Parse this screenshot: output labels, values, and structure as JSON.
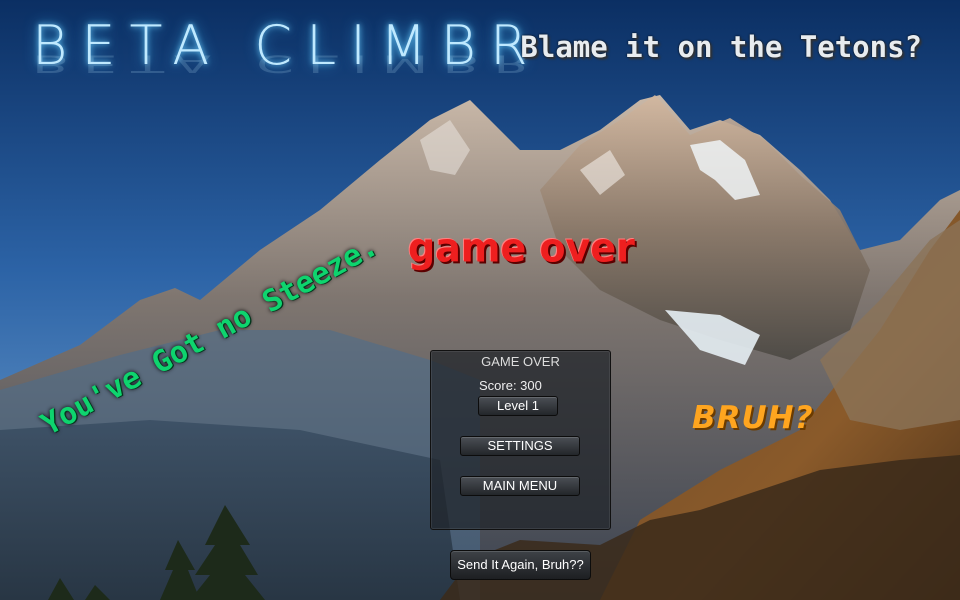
{
  "header": {
    "game_title": "BETA CLIMBR",
    "tagline": "Blame it on the Tetons?"
  },
  "overlay": {
    "game_over_banner": "game over",
    "taunt_left": "You've Got no Steeze.",
    "taunt_right": "BRUH?"
  },
  "panel": {
    "title": "GAME OVER",
    "score_text": "Score: 300",
    "level_label": "Level 1",
    "settings_label": "SETTINGS",
    "main_menu_label": "MAIN MENU"
  },
  "footer": {
    "retry_label": "Send It Again, Bruh??"
  },
  "colors": {
    "title_glow": "#6fd0ff",
    "banner_red": "#ee1f1f",
    "steeze_green": "#0ed46e",
    "bruh_orange": "#ffa51f"
  }
}
